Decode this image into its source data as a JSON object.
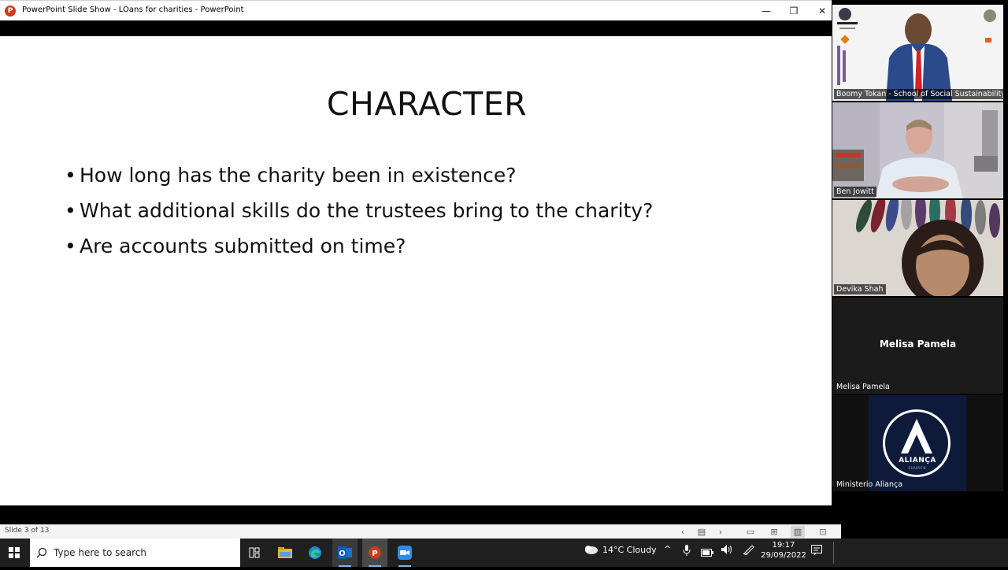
{
  "window": {
    "title": "PowerPoint Slide Show  -  LOans for charities  -  PowerPoint",
    "app_icon_letter": "P",
    "controls": {
      "minimize": "—",
      "restore": "❐",
      "close": "✕"
    }
  },
  "slide": {
    "title": "CHARACTER",
    "bullets": [
      "How long has the charity been in existence?",
      "What additional skills do the trustees bring to the charity?",
      "Are accounts submitted on time?"
    ],
    "bullet_glyph": "•"
  },
  "statusbar": {
    "slide_info": "Slide 3 of 13",
    "icons": [
      "prev-icon",
      "menu-icon",
      "next-icon",
      "normal-view-icon",
      "slide-sorter-icon",
      "reading-view-icon",
      "presenter-icon"
    ]
  },
  "participants": [
    {
      "name": "Boomy Tokan - School of Social Sustainability",
      "type": "video",
      "bg": "#f4f4f4"
    },
    {
      "name": "Ben Jowitt",
      "type": "video",
      "bg": "#c9c6cc"
    },
    {
      "name": "Devika Shah",
      "type": "video",
      "bg": "#ddd6cf"
    },
    {
      "name": "Melisa Pamela",
      "type": "no-video",
      "display": "Melisa Pamela",
      "bg": "#1b1b1b"
    },
    {
      "name": "Ministerio Aliança",
      "type": "logo",
      "logo_text": "ALIANÇA",
      "logo_sub": "CHURCH",
      "bg": "#0d1a3a"
    }
  ],
  "taskbar": {
    "search_placeholder": "Type here to search",
    "weather": "14°C  Cloudy",
    "time": "19:17",
    "date": "29/09/2022"
  },
  "colors": {
    "ppt_red": "#c43e1c",
    "taskbar": "#202020",
    "zoom_tile_dark": "#1b1b1b"
  }
}
